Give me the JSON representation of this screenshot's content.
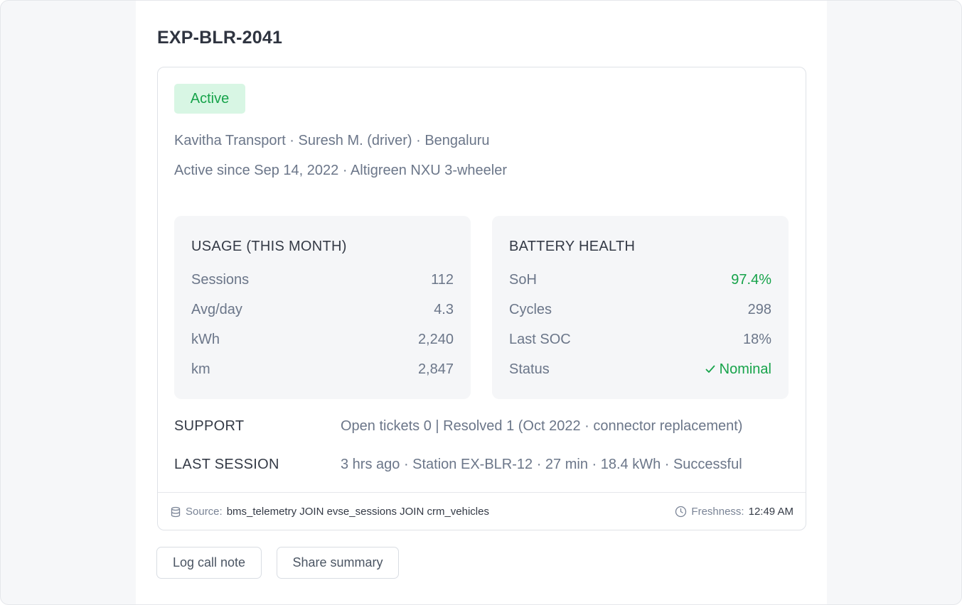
{
  "vehicle": {
    "id": "EXP-BLR-2041",
    "status_badge": "Active",
    "meta_line1": "Kavitha Transport · Suresh M. (driver) · Bengaluru",
    "meta_line2": "Active since Sep 14, 2022 · Altigreen NXU 3-wheeler"
  },
  "usage": {
    "title": "USAGE (THIS MONTH)",
    "rows": [
      {
        "label": "Sessions",
        "value": "112"
      },
      {
        "label": "Avg/day",
        "value": "4.3"
      },
      {
        "label": "kWh",
        "value": "2,240"
      },
      {
        "label": "km",
        "value": "2,847"
      }
    ]
  },
  "battery": {
    "title": "BATTERY HEALTH",
    "rows": [
      {
        "label": "SoH",
        "value": "97.4%"
      },
      {
        "label": "Cycles",
        "value": "298"
      },
      {
        "label": "Last SOC",
        "value": "18%"
      },
      {
        "label": "Status",
        "value": "Nominal"
      }
    ]
  },
  "support": {
    "label": "SUPPORT",
    "value": "Open tickets 0 | Resolved 1 (Oct 2022 · connector replacement)"
  },
  "last_session": {
    "label": "LAST SESSION",
    "value": "3 hrs ago · Station EX-BLR-12 · 27 min · 18.4 kWh · Successful"
  },
  "footer": {
    "source_label": "Source:",
    "source_value": "bms_telemetry JOIN evse_sessions JOIN crm_vehicles",
    "freshness_label": "Freshness:",
    "freshness_value": "12:49 AM"
  },
  "actions": {
    "log_call": "Log call note",
    "share": "Share summary"
  },
  "colors": {
    "success": "#16a34a",
    "badge_bg": "#d8f6e4",
    "muted_text": "#6b7689"
  },
  "icons": {
    "source": "database-icon",
    "freshness": "clock-icon",
    "status_ok": "check-icon"
  }
}
